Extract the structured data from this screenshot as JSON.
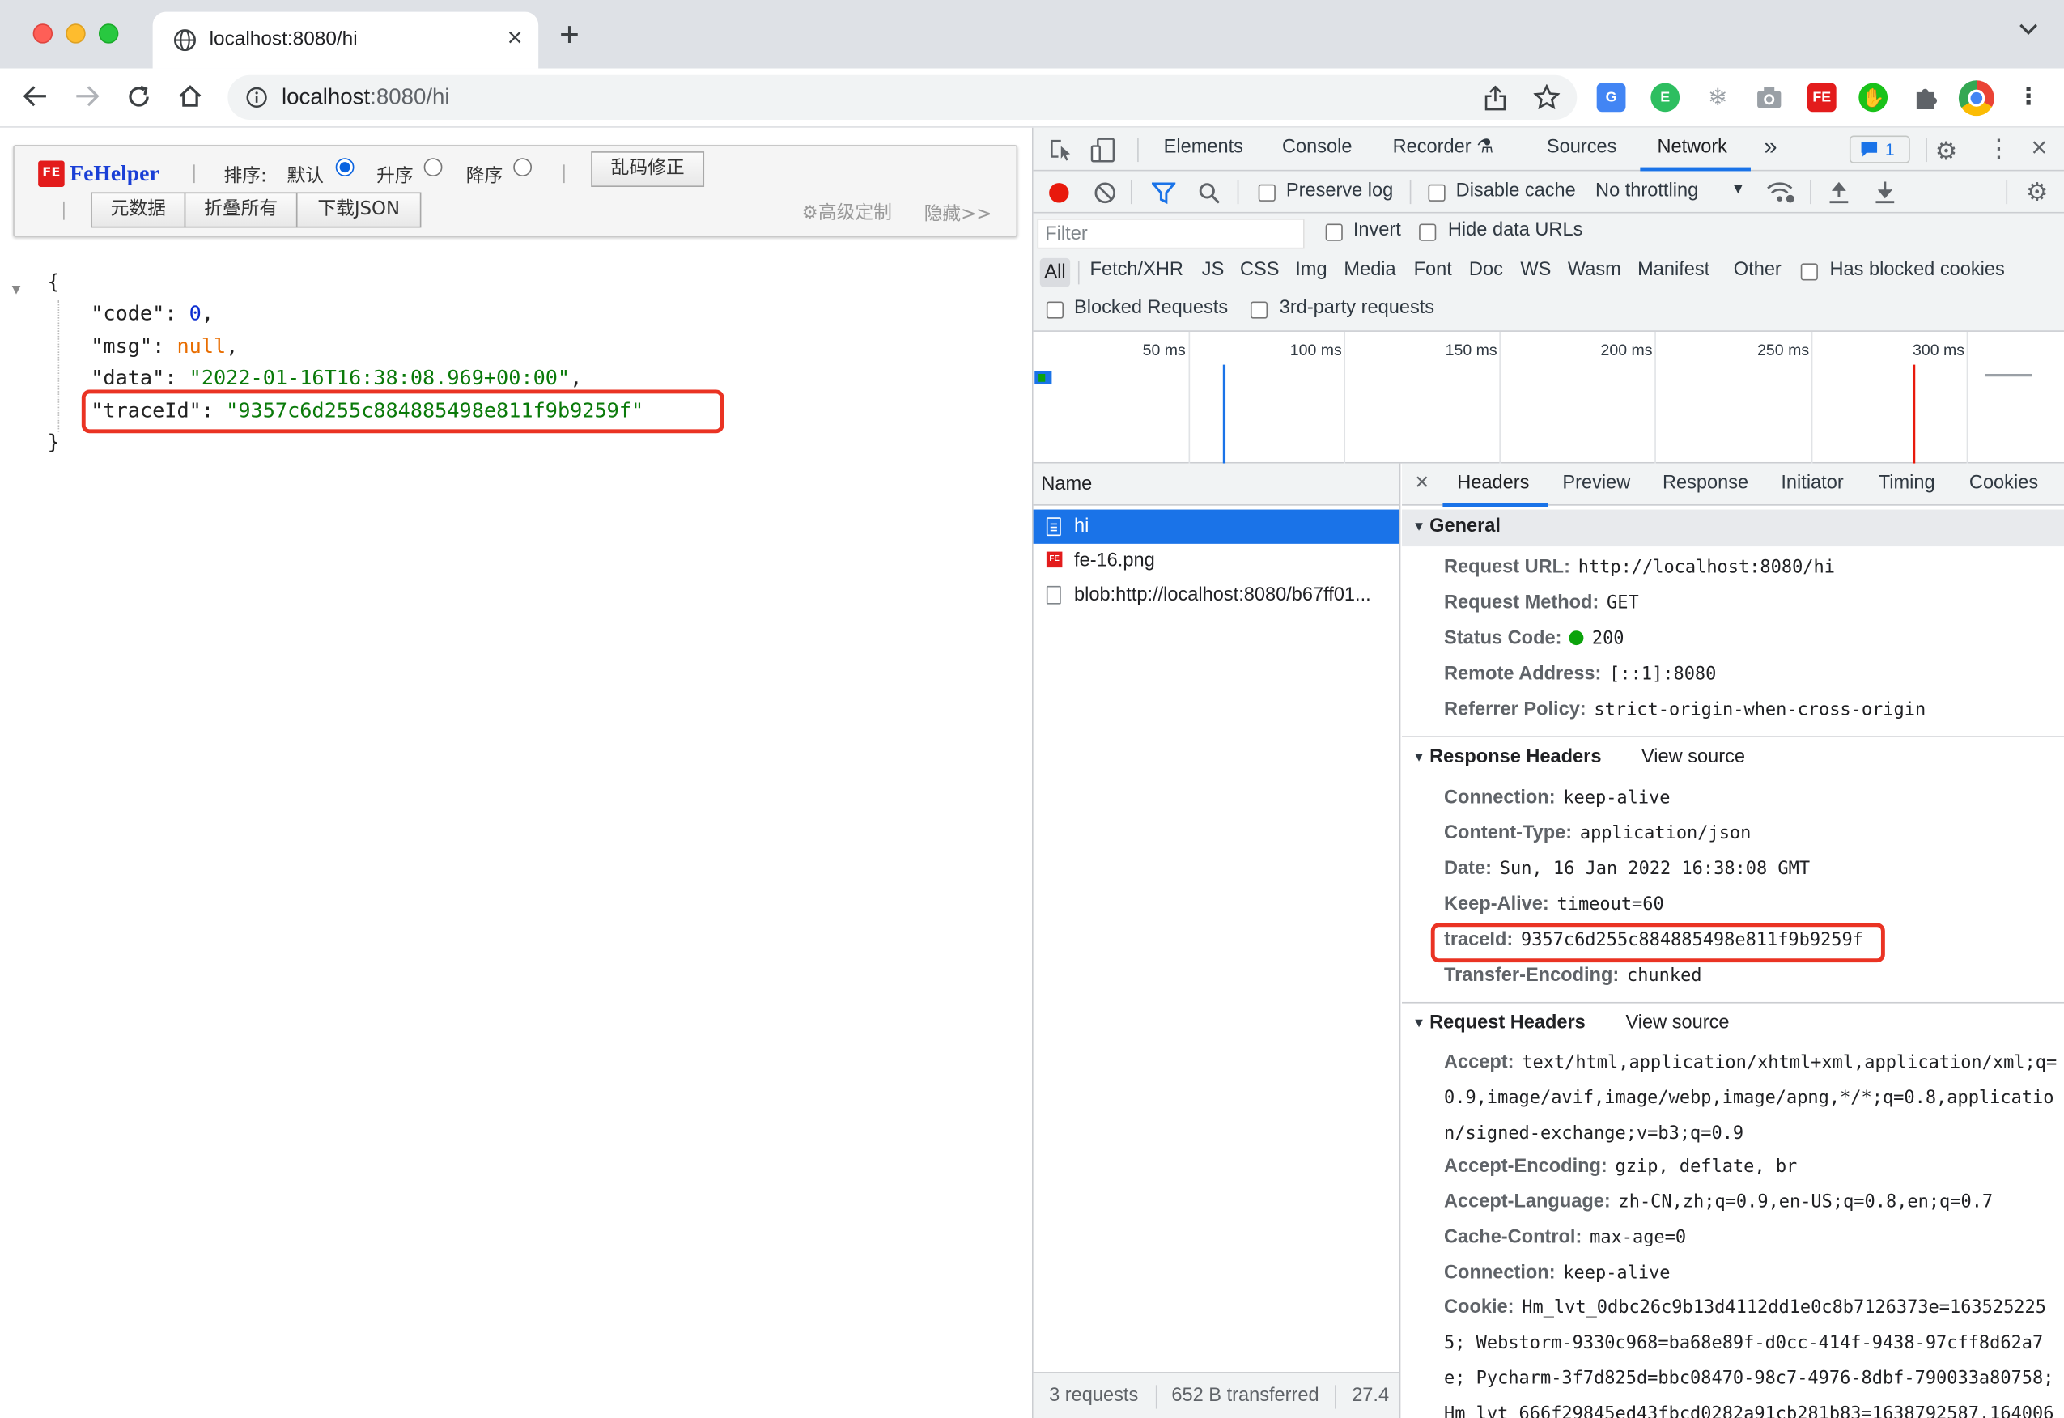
{
  "browser": {
    "tab_title": "localhost:8080/hi",
    "url_host": "localhost",
    "url_path": ":8080/hi",
    "extensions": [
      {
        "name": "translate-icon",
        "color": "#4285f4"
      },
      {
        "name": "evernote-icon",
        "color": "#2dbe60"
      },
      {
        "name": "snowflake-icon",
        "color": "#9aa0a6"
      },
      {
        "name": "camera-icon",
        "color": "#9aa0a6"
      },
      {
        "name": "fehelper-icon",
        "color": "#e31c1c",
        "text": "FE"
      },
      {
        "name": "green-ext-icon",
        "color": "#19c219"
      },
      {
        "name": "puzzle-icon",
        "color": "#5f6368"
      },
      {
        "name": "chrome-profile-icon",
        "color": "#ea4335"
      }
    ]
  },
  "fehelper": {
    "logo": "FeHelper",
    "sort_label": "排序:",
    "sort_default": "默认",
    "sort_asc": "升序",
    "sort_desc": "降序",
    "fix_button": "乱码修正",
    "metadata_button": "元数据",
    "collapse_button": "折叠所有",
    "download_button": "下载JSON",
    "advanced_link": "高级定制",
    "hide_link": "隐藏>>"
  },
  "json": {
    "open": "{",
    "close": "}",
    "lines": [
      {
        "key": "\"code\"",
        "value": "0",
        "type": "num"
      },
      {
        "key": "\"msg\"",
        "value": "null",
        "type": "null"
      },
      {
        "key": "\"data\"",
        "value": "\"2022-01-16T16:38:08.969+00:00\"",
        "type": "str"
      },
      {
        "key": "\"traceId\"",
        "value": "\"9357c6d255c884885498e811f9b9259f\"",
        "type": "str"
      }
    ]
  },
  "devtools": {
    "tabs": [
      "Elements",
      "Console",
      "Recorder",
      "Sources",
      "Network"
    ],
    "active_tab": "Network",
    "issues_count": "1",
    "preserve_log": "Preserve log",
    "disable_cache": "Disable cache",
    "throttling": "No throttling",
    "filter_placeholder": "Filter",
    "invert": "Invert",
    "hide_data_urls": "Hide data URLs",
    "type_filters": [
      "All",
      "Fetch/XHR",
      "JS",
      "CSS",
      "Img",
      "Media",
      "Font",
      "Doc",
      "WS",
      "Wasm",
      "Manifest",
      "Other"
    ],
    "has_blocked_cookies": "Has blocked cookies",
    "blocked_requests": "Blocked Requests",
    "third_party": "3rd-party requests",
    "timeline_ticks": [
      "50 ms",
      "100 ms",
      "150 ms",
      "200 ms",
      "250 ms",
      "300 ms"
    ],
    "name_header": "Name",
    "requests": [
      {
        "name": "hi",
        "selected": true
      },
      {
        "name": "fe-16.png",
        "selected": false
      },
      {
        "name": "blob:http://localhost:8080/b67ff01...",
        "selected": false
      }
    ],
    "footer": {
      "count": "3 requests",
      "transferred": "652 B transferred",
      "extra": "27.4"
    },
    "detail_tabs": [
      "Headers",
      "Preview",
      "Response",
      "Initiator",
      "Timing",
      "Cookies"
    ],
    "general_title": "General",
    "general": [
      {
        "k": "Request URL:",
        "v": "http://localhost:8080/hi"
      },
      {
        "k": "Request Method:",
        "v": "GET"
      },
      {
        "k": "Status Code:",
        "v": "200"
      },
      {
        "k": "Remote Address:",
        "v": "[::1]:8080"
      },
      {
        "k": "Referrer Policy:",
        "v": "strict-origin-when-cross-origin"
      }
    ],
    "response_title": "Response Headers",
    "view_source": "View source",
    "response": [
      {
        "k": "Connection:",
        "v": "keep-alive"
      },
      {
        "k": "Content-Type:",
        "v": "application/json"
      },
      {
        "k": "Date:",
        "v": "Sun, 16 Jan 2022 16:38:08 GMT"
      },
      {
        "k": "Keep-Alive:",
        "v": "timeout=60"
      },
      {
        "k": "traceId:",
        "v": "9357c6d255c884885498e811f9b9259f"
      },
      {
        "k": "Transfer-Encoding:",
        "v": "chunked"
      }
    ],
    "request_title": "Request Headers",
    "request": {
      "accept_k": "Accept:",
      "accept_v": "text/html,application/xhtml+xml,application/xml;q=0.9,image/avif,image/webp,image/apng,*/*;q=0.8,application/signed-exchange;v=b3;q=0.9",
      "encoding_k": "Accept-Encoding:",
      "encoding_v": "gzip, deflate, br",
      "language_k": "Accept-Language:",
      "language_v": "zh-CN,zh;q=0.9,en-US;q=0.8,en;q=0.7",
      "cache_k": "Cache-Control:",
      "cache_v": "max-age=0",
      "conn_k": "Connection:",
      "conn_v": "keep-alive",
      "cookie_k": "Cookie:",
      "cookie_v": "Hm_lvt_0dbc26c9b13d4112dd1e0c8b7126373e=1635252255; Webstorm-9330c968=ba68e89f-d0cc-414f-9438-97cff8d62a7e; Pycharm-3f7d825d=bbc08470-98c7-4976-8dbf-790033a80758; Hm_lvt_666f29845ed43fbcd0282a91cb281b83=1638792587,164006"
    }
  }
}
